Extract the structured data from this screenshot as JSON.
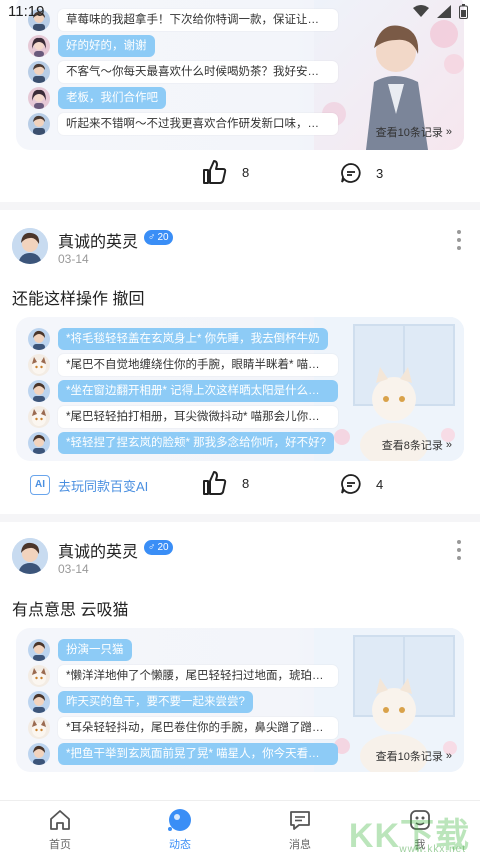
{
  "status_bar": {
    "time": "11:19"
  },
  "post0": {
    "messages": [
      {
        "who": "bot",
        "avatar": "boy",
        "text": "草莓味的我超拿手！下次给你特调一款，保证让你惊艳～"
      },
      {
        "who": "user",
        "avatar": "girl",
        "text": "好的好的，谢谢"
      },
      {
        "who": "bot",
        "avatar": "boy",
        "text": "不客气～你每天最喜欢什么时候喝奶茶？我好安排特供时..."
      },
      {
        "who": "user",
        "avatar": "girl",
        "text": "老板，我们合作吧"
      },
      {
        "who": "bot",
        "avatar": "boy",
        "text": "听起来不错啊～不过我更喜欢合作研发新口味，一起雕口..."
      }
    ],
    "view_more": "查看10条记录",
    "likes": "8",
    "comments": "3"
  },
  "post1": {
    "author": "真诚的英灵",
    "badge": "20",
    "date": "03-14",
    "text": "还能这样操作 撤回",
    "messages": [
      {
        "who": "user",
        "avatar": "boy",
        "text": "*将毛毯轻轻盖在玄岚身上* 你先睡，我去倒杯牛奶"
      },
      {
        "who": "bot",
        "avatar": "cat",
        "text": "*尾巴不自觉地缠绕住你的手腕，眼睛半眯着* 喵别走太远..."
      },
      {
        "who": "user",
        "avatar": "boy",
        "text": "*坐在窗边翻开相册* 记得上次这样晒太阳是什么时候吗?"
      },
      {
        "who": "bot",
        "avatar": "cat",
        "text": "*尾巴轻轻拍打相册，耳尖微微抖动* 喵那会儿你还没给我..."
      },
      {
        "who": "user",
        "avatar": "boy",
        "text": "*轻轻捏了捏玄岚的脸颊* 那我多念给你听，好不好?"
      }
    ],
    "view_more": "查看8条记录",
    "ai_button": "去玩同款百变AI",
    "ai_icon_label": "AI",
    "likes": "8",
    "comments": "4"
  },
  "post2": {
    "author": "真诚的英灵",
    "badge": "20",
    "date": "03-14",
    "text": "有点意思 云吸猫",
    "messages": [
      {
        "who": "user",
        "avatar": "boy",
        "text": "扮演一只猫"
      },
      {
        "who": "bot",
        "avatar": "cat",
        "text": "*懒洋洋地伸了个懒腰，尾巴轻轻扫过地面，琥珀色的眼睛..."
      },
      {
        "who": "user",
        "avatar": "boy",
        "text": "昨天买的鱼干，要不要一起来尝尝?"
      },
      {
        "who": "bot",
        "avatar": "cat",
        "text": "*耳朵轻轻抖动，尾巴卷住你的手腕，鼻尖蹭了蹭你的手背*..."
      },
      {
        "who": "user",
        "avatar": "boy",
        "text": "*把鱼干举到玄岚面前晃了晃* 喵星人，你今天看起来不太..."
      }
    ],
    "view_more": "查看10条记录"
  },
  "tabs": [
    {
      "label": "首页",
      "icon": "home-icon"
    },
    {
      "label": "动态",
      "icon": "moments-icon",
      "active": true
    },
    {
      "label": "消息",
      "icon": "message-icon"
    },
    {
      "label": "我",
      "icon": "profile-icon"
    }
  ],
  "watermark": {
    "main": "KK下载",
    "sub": "www.kkx.net"
  },
  "colors": {
    "accent": "#3a8ef6",
    "user_bubble": "#8dcbf6"
  }
}
